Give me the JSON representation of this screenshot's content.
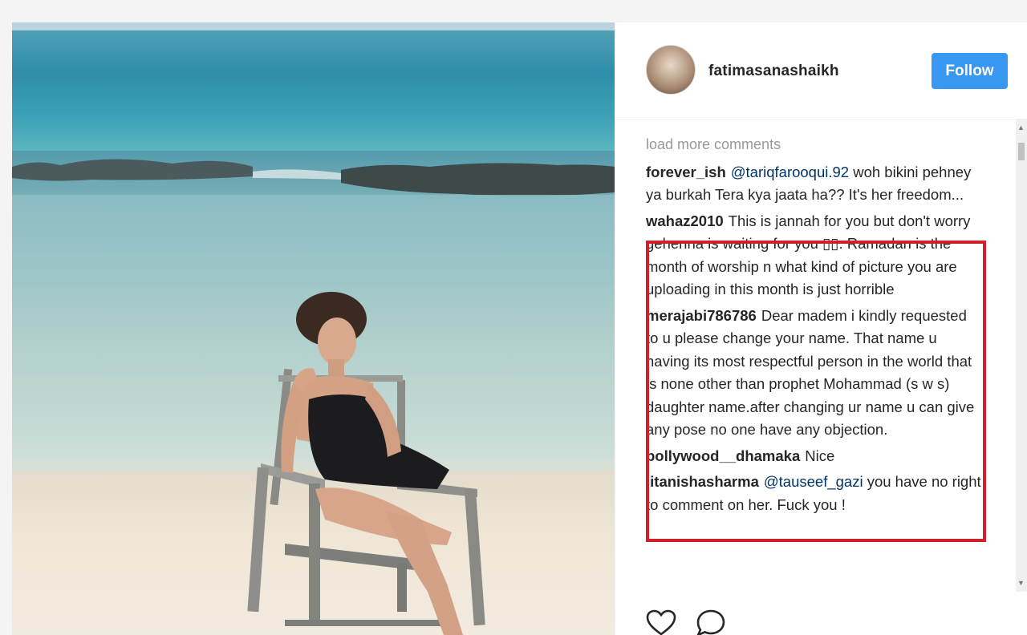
{
  "post": {
    "username": "fatimasanashaikh",
    "follow_label": "Follow"
  },
  "comments": {
    "load_more": "load more comments",
    "items": [
      {
        "user": "forever_ish",
        "mention": "@tariqfarooqui.92",
        "text": " woh bikini pehney ya burkah Tera kya jaata ha?? It's her freedom..."
      },
      {
        "user": "wahaz2010",
        "text": "This is jannah for you but don't worry gehenna is waiting for you ▯▯. Ramadan is the month of worship n what kind of picture you are uploading in this month is just horrible"
      },
      {
        "user": "merajabi786786",
        "text": "Dear madem i kindly requested to u please change your name. That name u having its most respectful person in the world that is none other than prophet Mohammad (s w s) daughter name.after changing ur name u can give any pose no one have any objection."
      },
      {
        "user": "bollywood__dhamaka",
        "text": "Nice"
      },
      {
        "user": "iitanishasharma",
        "mention": "@tauseef_gazi",
        "text": " you have no right to comment on her. Fuck you !"
      }
    ]
  },
  "icons": [
    "heart-icon",
    "comment-icon"
  ],
  "colors": {
    "follow": "#3897f0",
    "highlight": "#d1202c",
    "load_more": "#999999"
  }
}
